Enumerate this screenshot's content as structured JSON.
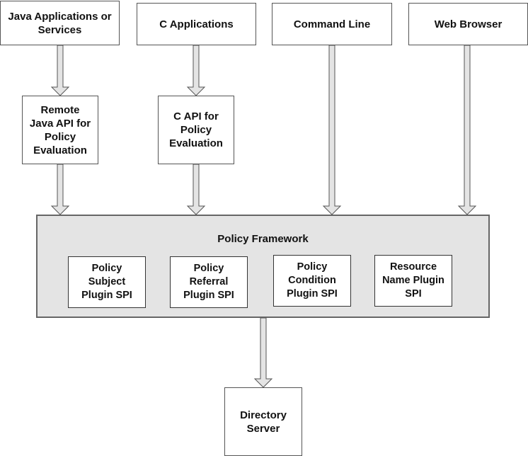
{
  "diagram": {
    "sources": [
      {
        "id": "java-apps",
        "label": "Java Applications or\nServices"
      },
      {
        "id": "c-apps",
        "label": "C Applications"
      },
      {
        "id": "command-line",
        "label": "Command Line"
      },
      {
        "id": "web-browser",
        "label": "Web Browser"
      }
    ],
    "apis": [
      {
        "id": "remote-java-api",
        "label": "Remote\nJava API for\nPolicy\nEvaluation"
      },
      {
        "id": "c-api",
        "label": "C API for\nPolicy\nEvaluation"
      }
    ],
    "framework": {
      "title": "Policy Framework",
      "plugins": [
        {
          "id": "subject-plugin",
          "label": "Policy\nSubject\nPlugin SPI"
        },
        {
          "id": "referral-plugin",
          "label": "Policy\nReferral\nPlugin SPI"
        },
        {
          "id": "condition-plugin",
          "label": "Policy\nCondition\nPlugin SPI"
        },
        {
          "id": "resource-name-plugin",
          "label": "Resource\nName Plugin\nSPI"
        }
      ]
    },
    "sink": {
      "id": "directory-server",
      "label": "Directory\nServer"
    },
    "edges": [
      [
        "java-apps",
        "remote-java-api"
      ],
      [
        "c-apps",
        "c-api"
      ],
      [
        "remote-java-api",
        "policy-framework"
      ],
      [
        "c-api",
        "policy-framework"
      ],
      [
        "command-line",
        "policy-framework"
      ],
      [
        "web-browser",
        "policy-framework"
      ],
      [
        "policy-framework",
        "directory-server"
      ]
    ],
    "colors": {
      "framework_fill": "#e4e4e4",
      "arrow_fill": "#e4e4e4",
      "stroke": "#555555"
    }
  }
}
